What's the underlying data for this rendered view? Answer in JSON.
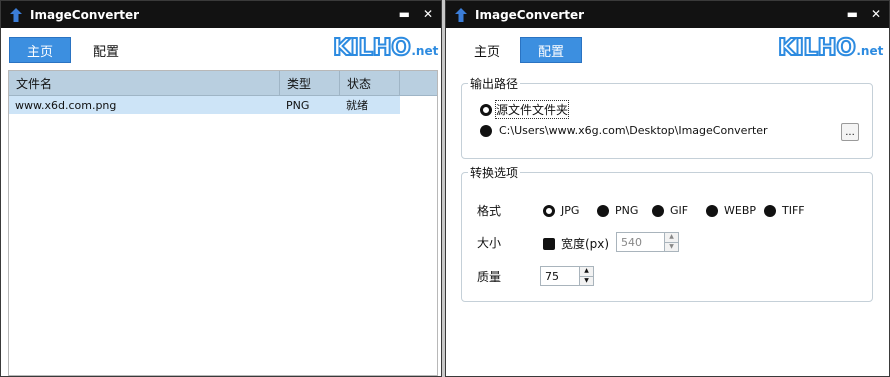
{
  "left_window": {
    "title": "ImageConverter",
    "minimize": "▬",
    "close": "✕",
    "tabs": [
      "主页",
      "配置"
    ],
    "logo": {
      "main": "KILHO",
      "sub": ".net"
    },
    "list": {
      "columns": [
        "文件名",
        "类型",
        "状态"
      ],
      "rows": [
        {
          "name": "www.x6d.com.png",
          "type": "PNG",
          "status": "就绪"
        }
      ]
    }
  },
  "right_window": {
    "title": "ImageConverter",
    "minimize": "▬",
    "close": "✕",
    "tabs": [
      "主页",
      "配置"
    ],
    "logo": {
      "main": "KILHO",
      "sub": ".net"
    },
    "output": {
      "title": "输出路径",
      "option_source": "源文件文件夹",
      "option_custom_path": "C:\\Users\\www.x6g.com\\Desktop\\ImageConverter",
      "browse_label": "..."
    },
    "convert": {
      "title": "转换选项",
      "format_label": "格式",
      "formats": [
        "JPG",
        "PNG",
        "GIF",
        "WEBP",
        "TIFF"
      ],
      "selected_format": "JPG",
      "size_label": "大小",
      "width_checkbox": "宽度(px)",
      "width_value": "540",
      "quality_label": "质量",
      "quality_value": "75"
    }
  },
  "colors": {
    "accent": "#3c8fe0",
    "titlebar": "#121212",
    "header": "#b9cfe0",
    "selected_row": "#cde4f7"
  }
}
